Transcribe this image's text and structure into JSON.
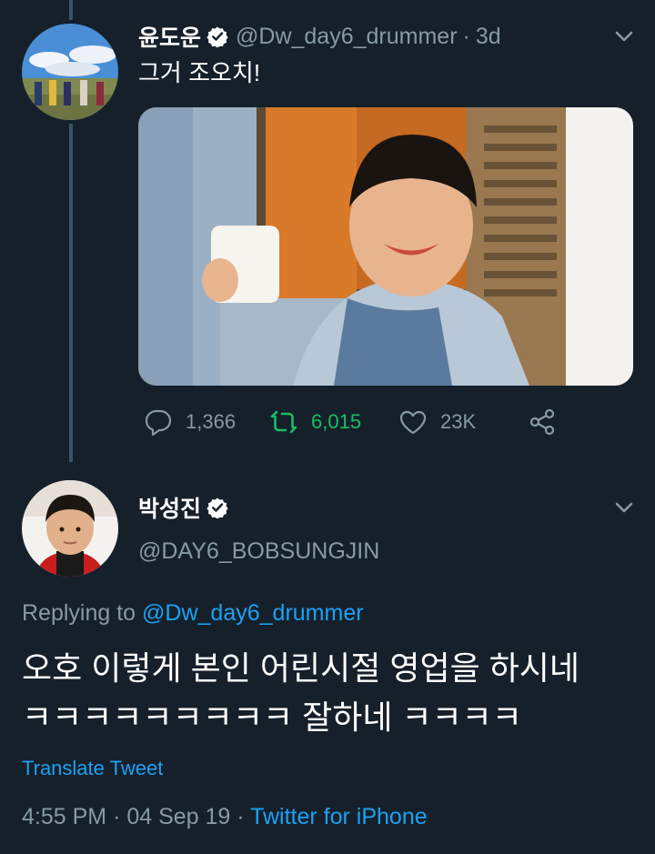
{
  "tweet": {
    "display_name": "윤도운",
    "handle": "@Dw_day6_drummer",
    "separator": "·",
    "time": "3d",
    "text": "그거 조오치!",
    "stats": {
      "replies": "1,366",
      "retweets": "6,015",
      "likes": "23K"
    }
  },
  "reply": {
    "display_name": "박성진",
    "handle": "@DAY6_BOBSUNGJIN",
    "replying_prefix": "Replying to",
    "replying_to": "@Dw_day6_drummer",
    "text": "오호 이렇게 본인 어린시절 영업을 하시네\nㅋㅋㅋㅋㅋㅋㅋㅋㅋ 잘하네 ㅋㅋㅋㅋ",
    "translate_label": "Translate Tweet",
    "timestamp": "4:55 PM · 04 Sep 19",
    "meta_separator": "·",
    "source": "Twitter for iPhone"
  },
  "colors": {
    "background": "#15202b",
    "secondary_text": "#8899a6",
    "link": "#1da1f2",
    "retweet_active": "#17bf63"
  },
  "icons": [
    "verified-badge-icon",
    "chevron-down-icon",
    "reply-icon",
    "retweet-icon",
    "like-icon",
    "share-icon"
  ]
}
